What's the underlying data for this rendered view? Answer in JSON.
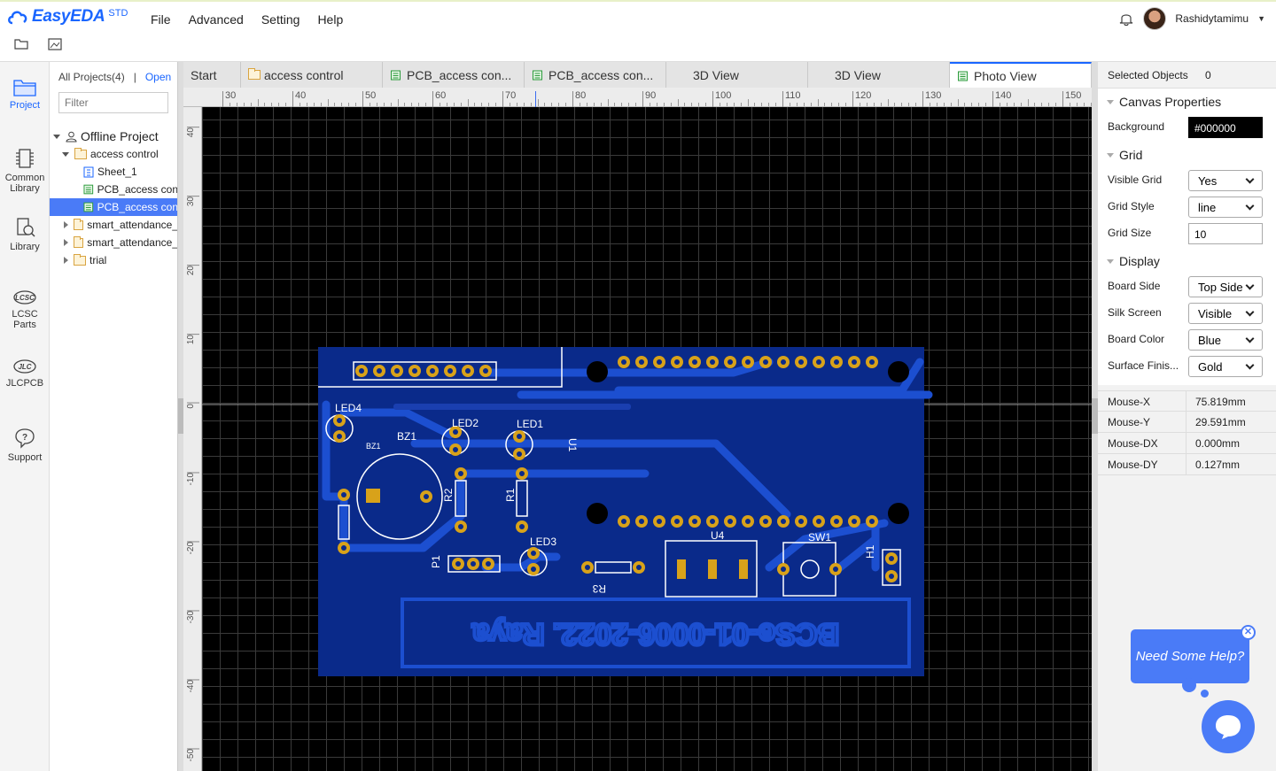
{
  "app": {
    "logo": "EasyEDA",
    "edition": "STD"
  },
  "menu": [
    "File",
    "Advanced",
    "Setting",
    "Help"
  ],
  "user": {
    "name": "Rashidytamimu"
  },
  "leftnav": [
    {
      "label": "Project",
      "icon": "folder-icon"
    },
    {
      "label": "Common Library",
      "icon": "chip-icon"
    },
    {
      "label": "Library",
      "icon": "search-library-icon"
    },
    {
      "label": "LCSC Parts",
      "icon": "lcsc-icon"
    },
    {
      "label": "JLCPCB",
      "icon": "jlc-icon"
    },
    {
      "label": "Support",
      "icon": "help-icon"
    }
  ],
  "project": {
    "all_projects": "All Projects(4)",
    "separator": "|",
    "open": "Open",
    "filter_placeholder": "Filter",
    "tree": {
      "root": "Offline Project",
      "items": [
        "access control",
        "Sheet_1",
        "PCB_access con",
        "PCB_access con",
        "smart_attendance_",
        "smart_attendance_",
        "trial"
      ]
    }
  },
  "tabs": [
    "Start",
    "access control",
    "PCB_access con...",
    "PCB_access con...",
    "3D View",
    "3D View",
    "Photo View"
  ],
  "ruler": {
    "top": [
      "30",
      "40",
      "50",
      "60",
      "70",
      "80",
      "90",
      "100",
      "110",
      "120",
      "130",
      "140",
      "150"
    ],
    "left": [
      "40",
      "30",
      "20",
      "10",
      "0",
      "-10",
      "-20",
      "-30",
      "-40",
      "-50"
    ]
  },
  "pcb": {
    "labels": [
      "LED4",
      "LED2",
      "LED1",
      "BZ1",
      "BZ1",
      "U1",
      "R2",
      "R1",
      "LED3",
      "P1",
      "R3",
      "U4",
      "SW1",
      "H1"
    ],
    "silk_text": "BCSe-01-0006-2022. Raya"
  },
  "right": {
    "selected_label": "Selected Objects",
    "selected_value": "0",
    "canvas_props": "Canvas Properties",
    "background_label": "Background",
    "background_value": "#000000",
    "grid_section": "Grid",
    "visible_grid_label": "Visible Grid",
    "visible_grid_value": "Yes",
    "grid_style_label": "Grid Style",
    "grid_style_value": "line",
    "grid_size_label": "Grid Size",
    "grid_size_value": "10",
    "display_section": "Display",
    "board_side_label": "Board Side",
    "board_side_value": "Top Side",
    "silk_label": "Silk Screen",
    "silk_value": "Visible",
    "board_color_label": "Board Color",
    "board_color_value": "Blue",
    "surface_label": "Surface Finis...",
    "surface_value": "Gold",
    "mouse": [
      {
        "k": "Mouse-X",
        "v": "75.819mm"
      },
      {
        "k": "Mouse-Y",
        "v": "29.591mm"
      },
      {
        "k": "Mouse-DX",
        "v": "0.000mm"
      },
      {
        "k": "Mouse-DY",
        "v": "0.127mm"
      }
    ]
  },
  "help": {
    "text": "Need Some Help?",
    "close": "✕"
  },
  "colors": {
    "accent": "#1a66ff",
    "board": "#0a2a8a",
    "trace": "#1c4fd0",
    "pad": "#d8a21a",
    "canvas": "#000000"
  }
}
